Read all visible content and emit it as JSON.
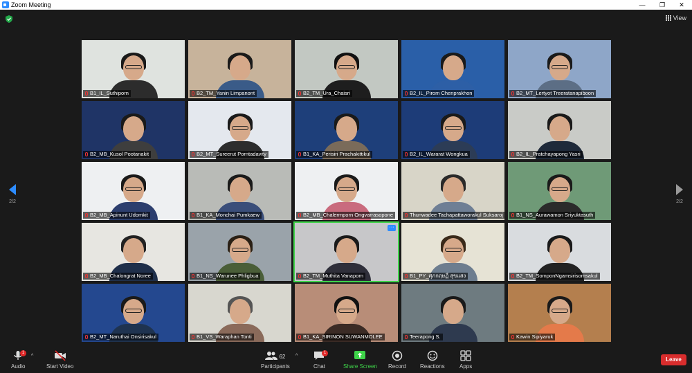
{
  "window": {
    "title": "Zoom Meeting",
    "minimize": "—",
    "restore": "❐",
    "close": "✕"
  },
  "view_label": "View",
  "pagination": {
    "left": "2/2",
    "right": "2/2"
  },
  "participants_grid": [
    [
      "B1_IL_Suthiporn",
      "B2_TM_Yanin Limpanont",
      "B2_TM_Ura_Chaisri",
      "B2_IL_Pirom Chenprakhon",
      "B2_MT_Lertyot Treeratanapiboon"
    ],
    [
      "B2_MB_Kusol Pootanakit",
      "B2_MT_Sureerut Porntadavity",
      "B1_KA_Perisiri Prachakittikul",
      "B2_IL_Wararat Wongkua",
      "B2_IL_Pratchayapong Yasri"
    ],
    [
      "B2_MB_Apinunt Udomkit",
      "B1_KA_Monchai Pumkaew",
      "B2_MB_Chalermporn Ongvarrasopone",
      "Thunwadee Tachapattaworakul Suksaroj",
      "B1_NS_Aurawamon Sriyuktasuth"
    ],
    [
      "B2_MB_Chalongrat Noree",
      "B1_NS_Warunee Phligbua",
      "B2_TM_Muthita Vanaporn",
      "B1_PY_ศุภกฤษฏิ์ สุขแสง",
      "B2_TM_SomponNgamsirisomsakul"
    ],
    [
      "B2_MT_Naruthai Onsirisakul",
      "B1_VS_Waraphan Tonti",
      "B1_KA_SIRINON SUWANMOLEE",
      "Teerapong S.",
      "Kawin Sipiyaruk"
    ]
  ],
  "toolbar": {
    "audio": "Audio",
    "audio_badge": "1",
    "video": "Start Video",
    "participants": "Participants",
    "participants_count": "62",
    "chat": "Chat",
    "chat_badge": "1",
    "share": "Share Screen",
    "record": "Record",
    "reactions": "Reactions",
    "apps": "Apps",
    "leave": "Leave"
  },
  "colors": {
    "accent": "#2d8cff",
    "share_green": "#3fd44a",
    "leave_red": "#d92d2d",
    "background": "#1a1a1a"
  }
}
